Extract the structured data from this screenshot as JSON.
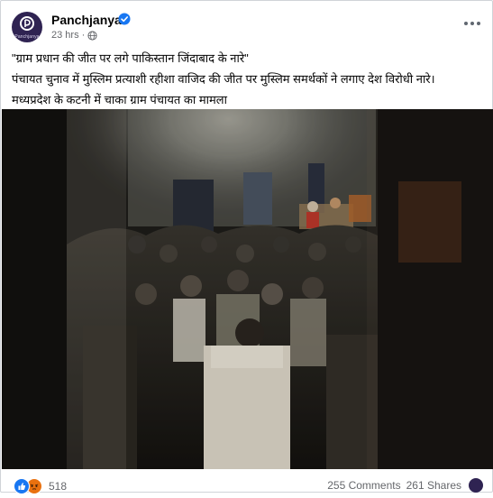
{
  "post": {
    "page_name": "Panchjanya",
    "time": "23 hrs",
    "separator": "·",
    "avatar_text": "Panchjanya",
    "lines": [
      "\"ग्राम प्रधान की जीत पर लगे पाकिस्तान जिंदाबाद के नारे\"",
      "पंचायत चुनाव में मुस्लिम प्रत्याशी रहीशा वाजिद की जीत पर मुस्लिम समर्थकों ने लगाए देश विरोधी नारे।",
      "मध्यप्रदेश के कटनी में चाका ग्राम पंचायत का मामला"
    ]
  },
  "footer": {
    "reaction_count": "518",
    "comments": "255 Comments",
    "shares": "261 Shares"
  },
  "colors": {
    "brand": "#2f2352",
    "verified": "#1877f2",
    "like": "#1877f2",
    "angry": "#e9710f",
    "meta_text": "#65676b"
  },
  "icons": [
    "verified-badge-icon",
    "globe-icon",
    "more-options-icon",
    "like-reaction-icon",
    "angry-reaction-icon"
  ]
}
